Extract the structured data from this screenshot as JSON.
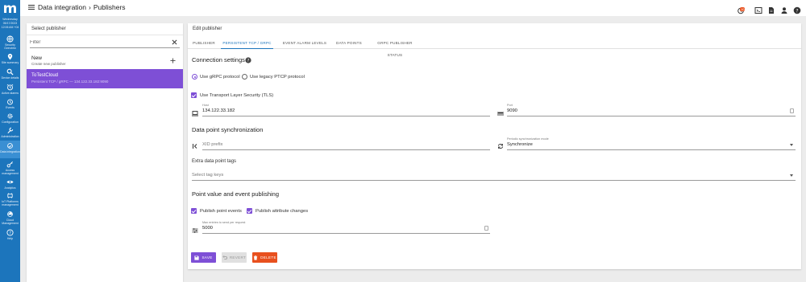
{
  "sidebar": {
    "logo": "m",
    "datetime": [
      "Wednesday",
      "05/17/2023",
      "12:06 AM +04"
    ],
    "items": [
      {
        "label": "Security Overview",
        "icon": "globe-icon"
      },
      {
        "label": "Site summary",
        "icon": "location-icon"
      },
      {
        "label": "Device details",
        "icon": "search-icon"
      },
      {
        "label": "Active alarms",
        "icon": "alarm-icon"
      },
      {
        "label": "Events",
        "icon": "alarm-clock-icon"
      },
      {
        "label": "Configuration",
        "icon": "gear-icon"
      },
      {
        "label": "Administration",
        "icon": "wrench-icon"
      },
      {
        "label": "Data integration",
        "icon": "sync-icon"
      },
      {
        "label": "Access management",
        "icon": "key-icon"
      },
      {
        "label": "Analytics",
        "icon": "eye-icon"
      },
      {
        "label": "IoT Platforms management",
        "icon": "iot-icon"
      },
      {
        "label": "Cloud Management",
        "icon": "cloud-icon"
      },
      {
        "label": "Help",
        "icon": "help-icon"
      }
    ]
  },
  "header": {
    "breadcrumb": [
      "Data integration",
      "Publishers"
    ],
    "alarm_badge": "10"
  },
  "left_panel": {
    "title": "Select publisher",
    "filter_placeholder": "Filter",
    "new_item": {
      "title": "New",
      "subtitle": "Create new publisher"
    },
    "selected_item": {
      "title": "ToTestCloud",
      "subtitle": "Persistent TCP / gRPC — 134.122.33.182:9090"
    }
  },
  "editor": {
    "title": "Edit publisher",
    "tabs": [
      "PUBLISHER",
      "PERSISTENT TCP / GRPC",
      "EVENT ALARM LEVELS",
      "DATA POINTS",
      "GRPC PUBLISHER STATUS"
    ],
    "active_tab": 1,
    "connection": {
      "title": "Connection settings",
      "radio_grpc": "Use gRPC protocol",
      "radio_ptcp": "Use legacy PTCP protocol",
      "tls_label": "Use Transport Layer Security (TLS)",
      "host_label": "Host",
      "host_value": "134.122.33.182",
      "port_label": "Port",
      "port_value": "9090"
    },
    "sync": {
      "title": "Data point synchronization",
      "xid_placeholder": "XID prefix",
      "mode_label": "Periodic synchronization mode",
      "mode_value": "Synchronize",
      "tags_title": "Extra data point tags",
      "tags_placeholder": "Select tag keys"
    },
    "publishing": {
      "title": "Point value and event publishing",
      "events_label": "Publish point events",
      "attr_label": "Publish attribute changes",
      "max_label": "Max entries to send per request",
      "max_value": "5000"
    },
    "buttons": {
      "save": "SAVE",
      "revert": "REVERT",
      "delete": "DELETE"
    }
  }
}
